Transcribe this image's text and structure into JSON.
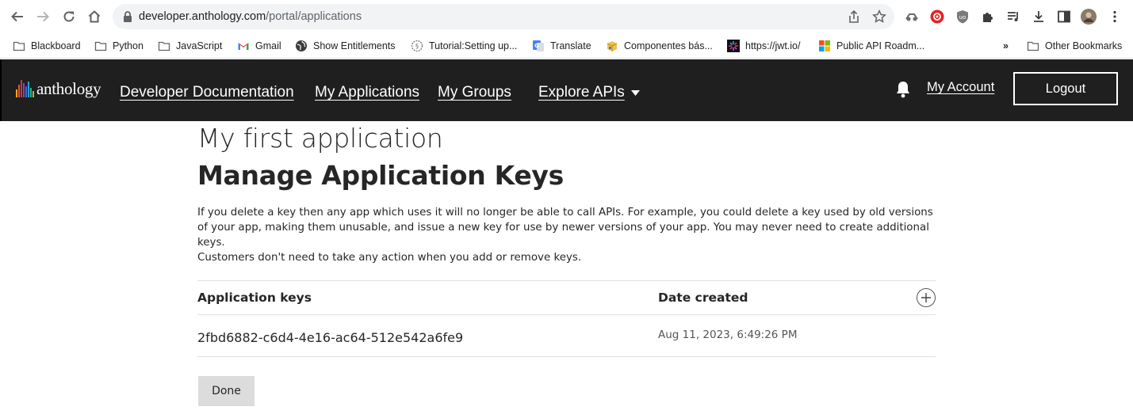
{
  "browser": {
    "url_host": "developer.anthology.com",
    "url_path": "/portal/applications",
    "bookmarks": [
      {
        "label": "Blackboard",
        "icon": "folder-icon"
      },
      {
        "label": "Python",
        "icon": "folder-icon"
      },
      {
        "label": "JavaScript",
        "icon": "folder-icon"
      },
      {
        "label": "Gmail",
        "icon": "gmail-icon"
      },
      {
        "label": "Show Entitlements",
        "icon": "globe-icon"
      },
      {
        "label": "Tutorial:Setting up...",
        "icon": "tutorial-icon"
      },
      {
        "label": "Translate",
        "icon": "translate-icon"
      },
      {
        "label": "Componentes bás...",
        "icon": "package-icon"
      },
      {
        "label": "https://jwt.io/",
        "icon": "jwt-icon"
      },
      {
        "label": "Public API Roadm...",
        "icon": "microsoft-icon"
      }
    ],
    "overflow_label": "»",
    "other_bookmarks_label": "Other Bookmarks"
  },
  "header": {
    "logo_text": "anthology",
    "nav": [
      {
        "label": "Developer Documentation"
      },
      {
        "label": "My Applications"
      },
      {
        "label": "My Groups"
      },
      {
        "label": "Explore APIs"
      }
    ],
    "account_label": "My Account",
    "logout_label": "Logout",
    "logo_colors": [
      "#f5a623",
      "#e8542a",
      "#d92b62",
      "#8e3fb4",
      "#3b6fd6",
      "#1fa3d8",
      "#33b36b",
      "#9bc53d"
    ]
  },
  "main": {
    "app_name": "My first application",
    "title": "Manage Application Keys",
    "description": "If you delete a key then any app which uses it will no longer be able to call APIs. For example, you could delete a key used by old versions of your app, making them unusable, and issue a new key for use by newer versions of your app. You may never need to create additional keys.",
    "note": "Customers don't need to take any action when you add or remove keys.",
    "table": {
      "headers": {
        "key": "Application keys",
        "date": "Date created"
      },
      "rows": [
        {
          "key": "2fbd6882-c6d4-4e16-ac64-512e542a6fe9",
          "date": "Aug 11, 2023, 6:49:26 PM"
        }
      ]
    },
    "done_label": "Done"
  }
}
